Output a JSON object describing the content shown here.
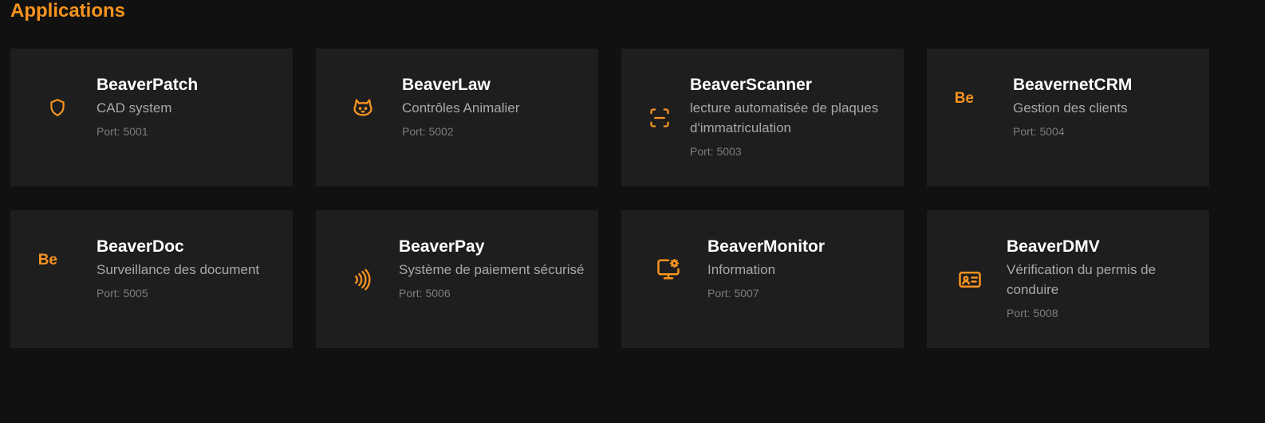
{
  "section": {
    "title": "Applications"
  },
  "accent_color": "#f7931e",
  "apps": [
    {
      "name": "BeaverPatch",
      "description": "CAD system",
      "port": "Port: 5001",
      "icon": "shield-icon"
    },
    {
      "name": "BeaverLaw",
      "description": "Contrôles Animalier",
      "port": "Port: 5002",
      "icon": "cat-icon"
    },
    {
      "name": "BeaverScanner",
      "description": "lecture automatisée de plaques d'immatriculation",
      "port": "Port: 5003",
      "icon": "scan-icon"
    },
    {
      "name": "BeavernetCRM",
      "description": "Gestion des clients",
      "port": "Port: 5004",
      "icon": "behance-icon",
      "icon_text": "Be"
    },
    {
      "name": "BeaverDoc",
      "description": "Surveillance des document",
      "port": "Port: 5005",
      "icon": "behance-icon",
      "icon_text": "Be"
    },
    {
      "name": "BeaverPay",
      "description": "Système de paiement sécurisé",
      "port": "Port: 5006",
      "icon": "contactless-icon"
    },
    {
      "name": "BeaverMonitor",
      "description": "Information",
      "port": "Port: 5007",
      "icon": "monitor-cog-icon"
    },
    {
      "name": "BeaverDMV",
      "description": "Vérification du permis de conduire",
      "port": "Port: 5008",
      "icon": "id-card-icon"
    }
  ]
}
